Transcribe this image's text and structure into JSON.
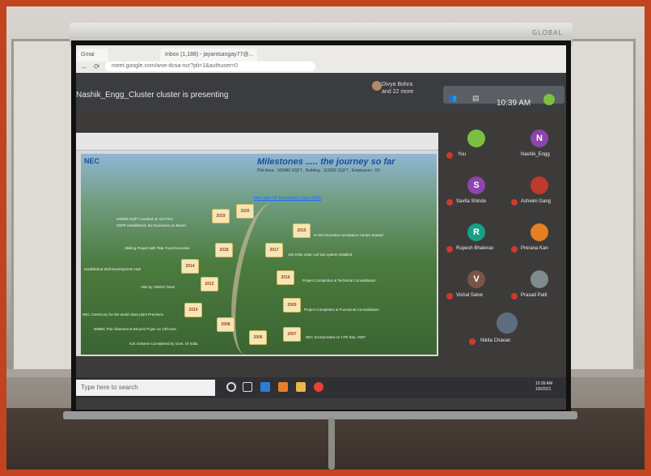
{
  "meet": {
    "tab_gmail": "Gmai",
    "tab_inbox": "Inbox (1,188) - jayantsangay77@...",
    "url": "meet.google.com/wve-dcsa-ncr?pli=1&authuser=0",
    "presenter_initial": "N",
    "presenting_text": "Nashik_Engg_Cluster cluster is presenting",
    "people_name": "Divya Bohra",
    "people_more": "and 22 more",
    "time": "10:39 AM",
    "grid_count": "23"
  },
  "slide": {
    "title_left": "Milestones .....",
    "title_right": "the journey so far",
    "subtitle": "Plot Area : 165880 SQFT , Building : 115000 SQFT , Employees : 60",
    "logo": "NEC",
    "link": "MoU with HP Foundation (Sept 2023)",
    "milestones": [
      {
        "year": "2019",
        "text": "200000 SQFT cracked on 1st Floor"
      },
      {
        "year": "2020",
        "text": "SSPP established. Six Nominees on Board"
      },
      {
        "year": "2015",
        "text": "N-Vel Innovation-Incubation Centre Started"
      },
      {
        "year": "2018",
        "text": "Skilling Project with Tata Trust Executive"
      },
      {
        "year": "2017",
        "text": "150 KWp solar roof top system installed"
      },
      {
        "year": "2014",
        "text": "Established Skill Development Hub"
      },
      {
        "year": "2016",
        "text": "Project Completion & Technical Consolidation"
      },
      {
        "year": "2012",
        "text": "Visit by UNIDO Team"
      },
      {
        "year": "2010",
        "text": "NEC Ceremony for the world class plant Premises"
      },
      {
        "year": "2009",
        "text": "Project Completion & Functional Consolidation"
      },
      {
        "year": "2008",
        "text": "NIMBC Plot Allotment & Bhoomi Pujan on 12th Dec"
      },
      {
        "year": "2007",
        "text": "NEC Incorporated on 17th Sep. 2007"
      },
      {
        "year": "2006",
        "text": "IUS Scheme Considered by Govt. Of India"
      }
    ]
  },
  "participants": [
    {
      "name": "You",
      "initial": "",
      "color": "#7bc043"
    },
    {
      "name": "Nashik_Engg",
      "initial": "N",
      "color": "#8e44ad"
    },
    {
      "name": "Savita Shinde",
      "initial": "S",
      "color": "#8e44ad"
    },
    {
      "name": "Ashwini Gang",
      "initial": "",
      "color": "#c0392b"
    },
    {
      "name": "Rupesh Bhalerao",
      "initial": "R",
      "color": "#16a085"
    },
    {
      "name": "Prerana Kan",
      "initial": "",
      "color": "#e67e22"
    },
    {
      "name": "Vishal Salve",
      "initial": "V",
      "color": "#795548"
    },
    {
      "name": "Prasad Patil",
      "initial": "",
      "color": "#7f8c8d"
    },
    {
      "name": "Nikita Chavan",
      "initial": "",
      "color": "#5d6d7e"
    }
  ],
  "taskbar": {
    "search_placeholder": "Type here to search",
    "clock_time": "10:39 AM",
    "clock_date": "1/8/2021"
  },
  "screen_brand": "GLOBAL"
}
